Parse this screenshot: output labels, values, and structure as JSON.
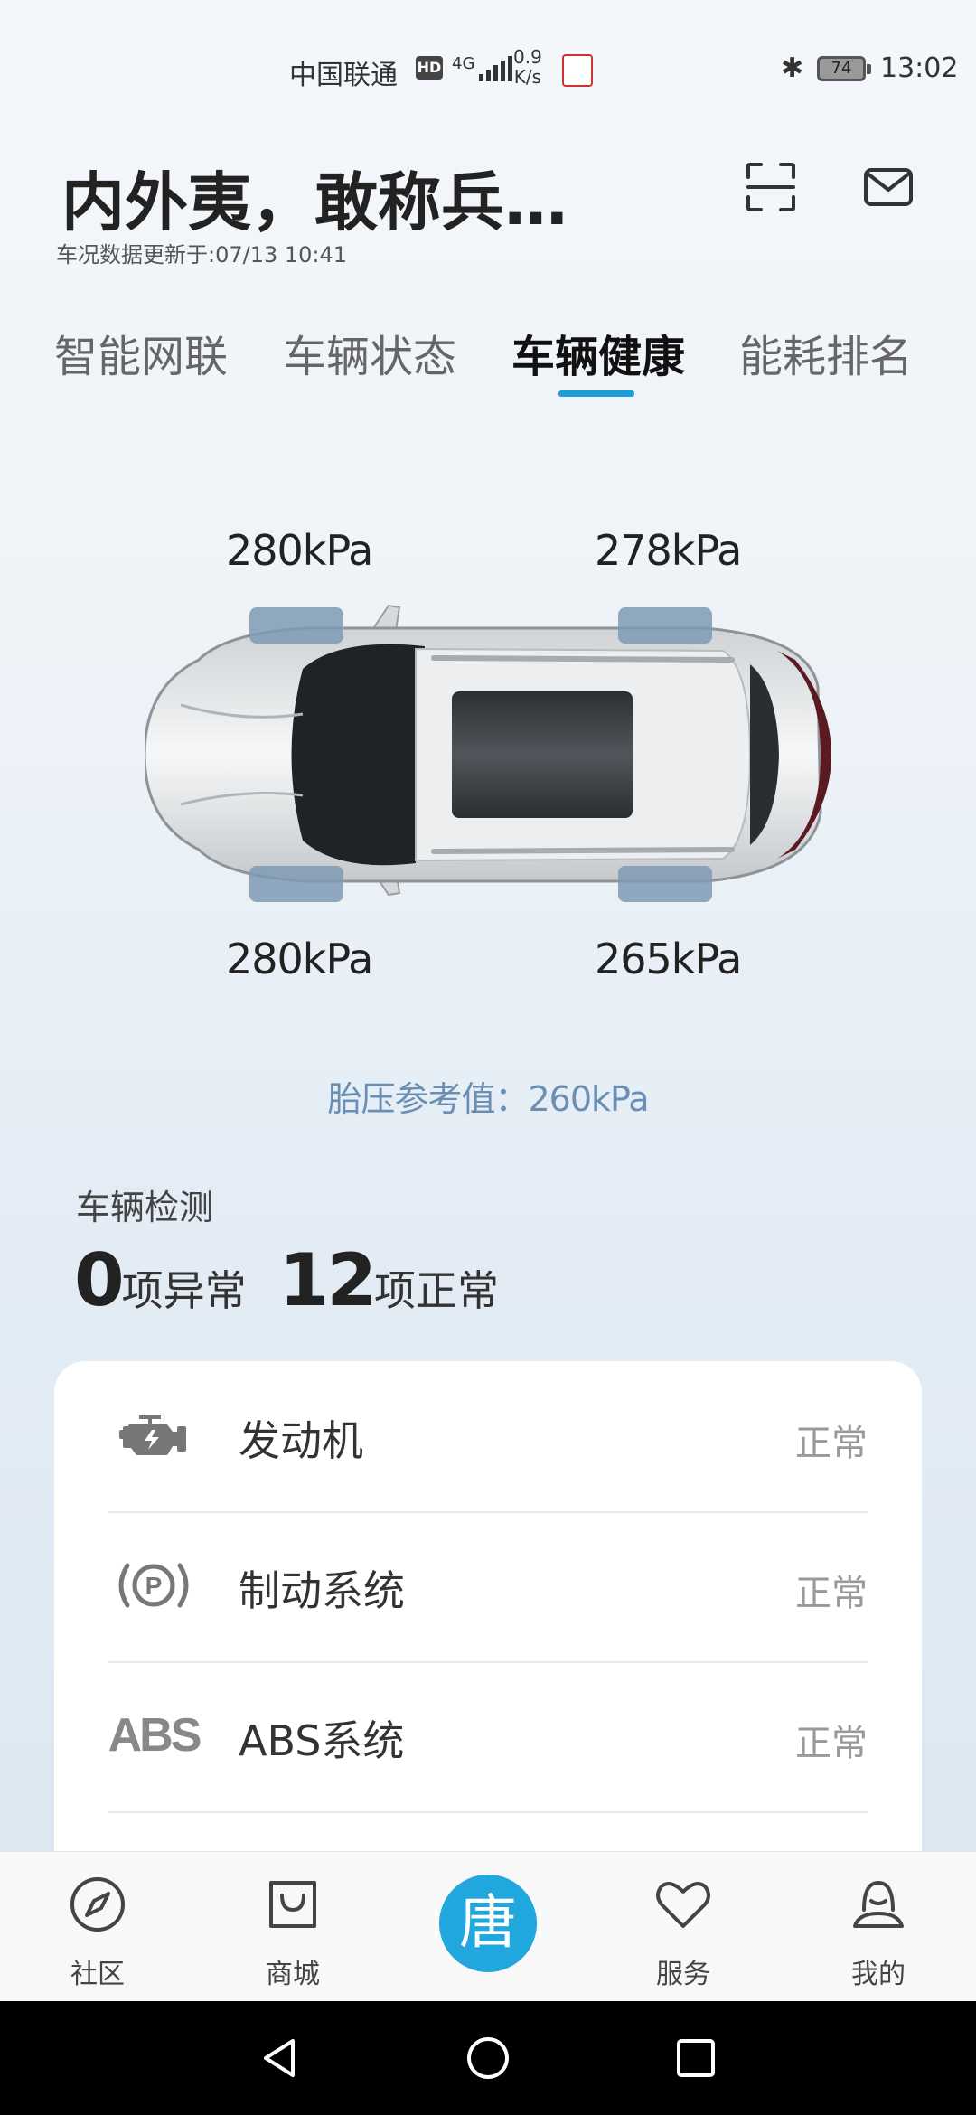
{
  "status_bar": {
    "carrier": "中国联通",
    "hd": "HD",
    "network": "4G",
    "speed_value": "0.9",
    "speed_unit": "K/s",
    "battery": "74",
    "time": "13:02"
  },
  "header": {
    "title": "内外夷，敢称兵…",
    "updated": "车况数据更新于:07/13 10:41"
  },
  "tabs": [
    {
      "label": "智能网联",
      "active": false
    },
    {
      "label": "车辆状态",
      "active": false
    },
    {
      "label": "车辆健康",
      "active": true
    },
    {
      "label": "能耗排名",
      "active": false
    }
  ],
  "tire_pressure": {
    "front_left": "280kPa",
    "front_right": "278kPa",
    "rear_left": "280kPa",
    "rear_right": "265kPa",
    "reference_label": "胎压参考值：",
    "reference_value": "260kPa"
  },
  "detection": {
    "label": "车辆检测",
    "abnormal_count": "0",
    "abnormal_text": "项异常",
    "normal_count": "12",
    "normal_text": "项正常"
  },
  "checks": [
    {
      "icon": "engine-icon",
      "label": "发动机",
      "status": "正常"
    },
    {
      "icon": "parking-brake-icon",
      "label": "制动系统",
      "status": "正常"
    },
    {
      "icon": "abs-icon",
      "icon_text": "ABS",
      "label": "ABS系统",
      "status": "正常"
    }
  ],
  "bottom_nav": {
    "items": [
      {
        "label": "社区",
        "icon": "compass-icon"
      },
      {
        "label": "商城",
        "icon": "shopping-bag-icon"
      },
      {
        "label": "服务",
        "icon": "heart-icon"
      },
      {
        "label": "我的",
        "icon": "profile-icon"
      }
    ],
    "center_label": "唐",
    "accent": "#1fa7de"
  },
  "colors": {
    "tab_indicator": "#1e9ed8",
    "reference_text": "#6a8fb3"
  }
}
